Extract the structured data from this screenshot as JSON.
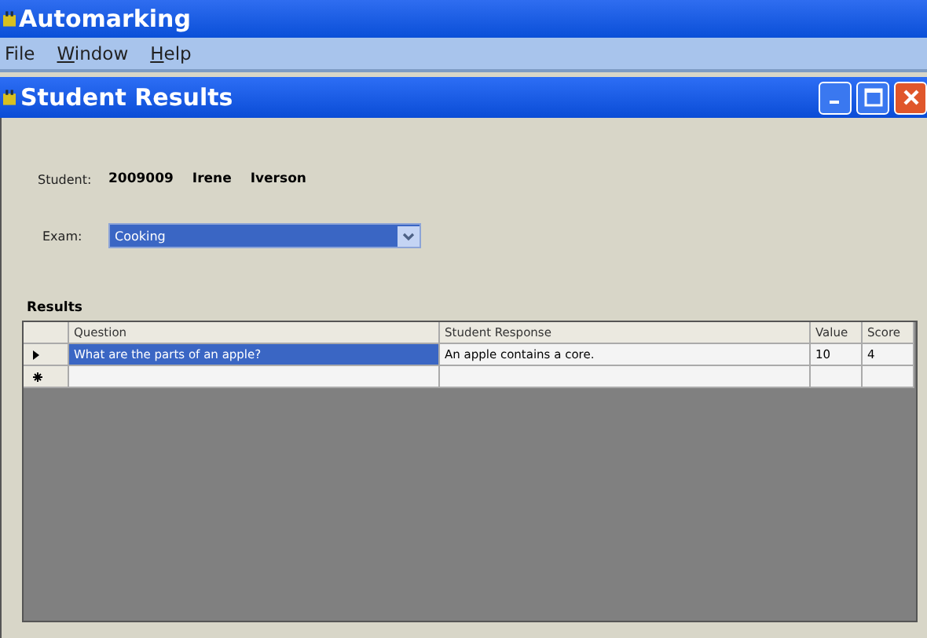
{
  "app": {
    "title": "Automarking"
  },
  "menu": [
    {
      "label": "File",
      "mnemonic": false
    },
    {
      "label": "Window",
      "mnemonic": true
    },
    {
      "label": "Help",
      "mnemonic": true
    }
  ],
  "window": {
    "title": "Student Results"
  },
  "student": {
    "label": "Student:",
    "id": "2009009",
    "first_name": "Irene",
    "last_name": "Iverson"
  },
  "exam": {
    "label": "Exam:",
    "value": "Cooking"
  },
  "results": {
    "title": "Results",
    "columns": [
      "Question",
      "Student Response",
      "Value",
      "Score"
    ],
    "rows": [
      {
        "kind": "current",
        "selected": true,
        "cells": [
          "What are the parts of an apple?",
          "An apple contains a core.",
          "10",
          "4"
        ]
      },
      {
        "kind": "new",
        "selected": false,
        "cells": [
          "",
          "",
          "",
          ""
        ]
      }
    ]
  }
}
